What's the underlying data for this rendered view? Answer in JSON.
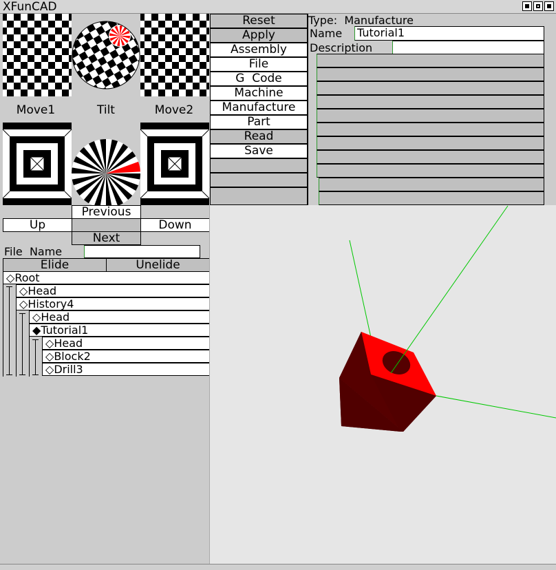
{
  "window": {
    "title": "FunCAD"
  },
  "nav": {
    "move1": "Move1",
    "tilt": "Tilt",
    "move2": "Move2",
    "previous": "Previous",
    "up": "Up",
    "down": "Down",
    "next": "Next"
  },
  "commands": [
    "Reset",
    "Apply",
    "Assembly",
    "File",
    "G  Code",
    "Machine",
    "Manufacture",
    "Part",
    "Read",
    "Save",
    "",
    "",
    ""
  ],
  "properties": {
    "type_label": "Type:",
    "type_value": "Manufacture",
    "name_label": "Name",
    "name_value": "Tutorial1",
    "description_label": "Description",
    "description_value": ""
  },
  "file": {
    "label": "File  Name",
    "value": ""
  },
  "tree_actions": {
    "elide": "Elide",
    "unelide": "Unelide"
  },
  "tree": [
    {
      "label": "Root",
      "symbol": "◇"
    },
    {
      "label": "Head",
      "symbol": "◇"
    },
    {
      "label": "History4",
      "symbol": "◇"
    },
    {
      "label": "Head",
      "symbol": "◇"
    },
    {
      "label": "Tutorial1",
      "symbol": "◆"
    },
    {
      "label": "Head",
      "symbol": "◇"
    },
    {
      "label": "Block2",
      "symbol": "◇"
    },
    {
      "label": "Drill3",
      "symbol": "◇"
    }
  ],
  "colors": {
    "accent_red": "#ff0000",
    "axis_green": "#00cc00",
    "viewport_bg": "#e6e6e6"
  }
}
